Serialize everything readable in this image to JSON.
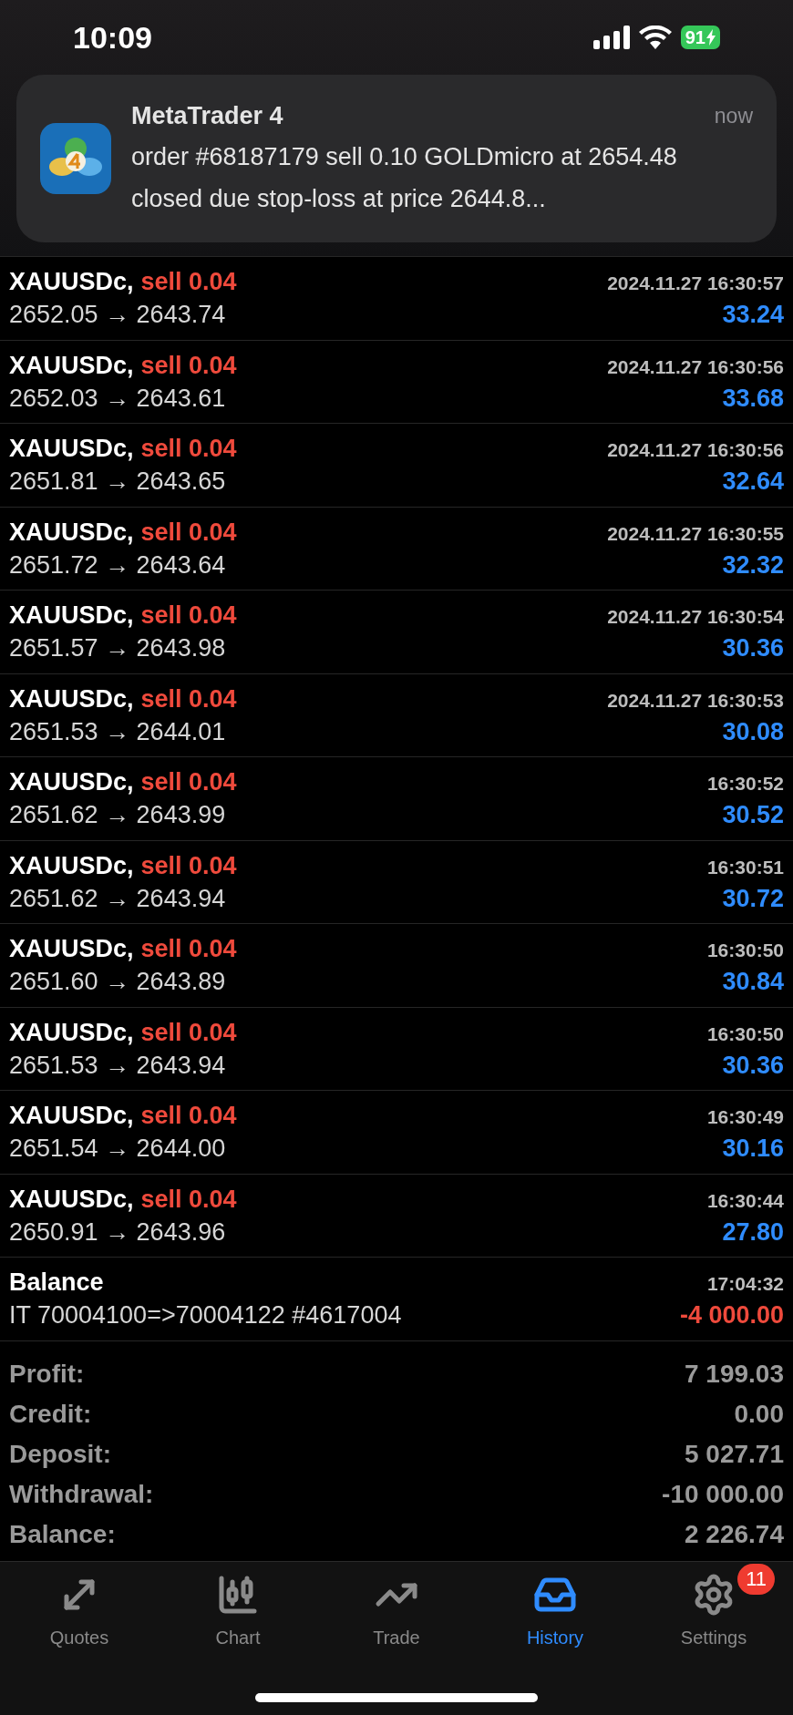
{
  "status_bar": {
    "time": "10:09",
    "battery": "91"
  },
  "notification": {
    "app": "MetaTrader 4",
    "time": "now",
    "message": "order #68187179 sell 0.10 GOLDmicro at 2654.48 closed due stop-loss at price 2644.8..."
  },
  "history": [
    {
      "kind": "trade",
      "symbol": "XAUUSDc,",
      "side": "sell 0.04",
      "time": "2024.11.27 16:30:57",
      "prices": "2652.05 → 2643.74",
      "amount": "33.24",
      "negative": false
    },
    {
      "kind": "trade",
      "symbol": "XAUUSDc,",
      "side": "sell 0.04",
      "time": "2024.11.27 16:30:56",
      "prices": "2652.03 → 2643.61",
      "amount": "33.68",
      "negative": false
    },
    {
      "kind": "trade",
      "symbol": "XAUUSDc,",
      "side": "sell 0.04",
      "time": "2024.11.27 16:30:56",
      "prices": "2651.81 → 2643.65",
      "amount": "32.64",
      "negative": false
    },
    {
      "kind": "trade",
      "symbol": "XAUUSDc,",
      "side": "sell 0.04",
      "time": "2024.11.27 16:30:55",
      "prices": "2651.72 → 2643.64",
      "amount": "32.32",
      "negative": false
    },
    {
      "kind": "trade",
      "symbol": "XAUUSDc,",
      "side": "sell 0.04",
      "time": "2024.11.27 16:30:54",
      "prices": "2651.57 → 2643.98",
      "amount": "30.36",
      "negative": false
    },
    {
      "kind": "trade",
      "symbol": "XAUUSDc,",
      "side": "sell 0.04",
      "time": "2024.11.27 16:30:53",
      "prices": "2651.53 → 2644.01",
      "amount": "30.08",
      "negative": false
    },
    {
      "kind": "trade",
      "symbol": "XAUUSDc,",
      "side": "sell 0.04",
      "time": "16:30:52",
      "prices": "2651.62 → 2643.99",
      "amount": "30.52",
      "negative": false
    },
    {
      "kind": "trade",
      "symbol": "XAUUSDc,",
      "side": "sell 0.04",
      "time": "16:30:51",
      "prices": "2651.62 → 2643.94",
      "amount": "30.72",
      "negative": false
    },
    {
      "kind": "trade",
      "symbol": "XAUUSDc,",
      "side": "sell 0.04",
      "time": "16:30:50",
      "prices": "2651.60 → 2643.89",
      "amount": "30.84",
      "negative": false
    },
    {
      "kind": "trade",
      "symbol": "XAUUSDc,",
      "side": "sell 0.04",
      "time": "16:30:50",
      "prices": "2651.53 → 2643.94",
      "amount": "30.36",
      "negative": false
    },
    {
      "kind": "trade",
      "symbol": "XAUUSDc,",
      "side": "sell 0.04",
      "time": "16:30:49",
      "prices": "2651.54 → 2644.00",
      "amount": "30.16",
      "negative": false
    },
    {
      "kind": "trade",
      "symbol": "XAUUSDc,",
      "side": "sell 0.04",
      "time": "16:30:44",
      "prices": "2650.91 → 2643.96",
      "amount": "27.80",
      "negative": false
    },
    {
      "kind": "balance",
      "symbol": "Balance",
      "time": "17:04:32",
      "prices": "IT 70004100=>70004122 #4617004",
      "amount": "-4 000.00",
      "negative": true
    }
  ],
  "summary": [
    {
      "label": "Profit:",
      "value": "7 199.03"
    },
    {
      "label": "Credit:",
      "value": "0.00"
    },
    {
      "label": "Deposit:",
      "value": "5 027.71"
    },
    {
      "label": "Withdrawal:",
      "value": "-10 000.00"
    },
    {
      "label": "Balance:",
      "value": "2 226.74"
    }
  ],
  "tabs": [
    {
      "kind": "quotes",
      "label": "Quotes",
      "selected": false
    },
    {
      "kind": "chart",
      "label": "Chart",
      "selected": false
    },
    {
      "kind": "trade",
      "label": "Trade",
      "selected": false
    },
    {
      "kind": "history",
      "label": "History",
      "selected": true
    },
    {
      "kind": "settings",
      "label": "Settings",
      "selected": false,
      "badge": "11"
    }
  ]
}
